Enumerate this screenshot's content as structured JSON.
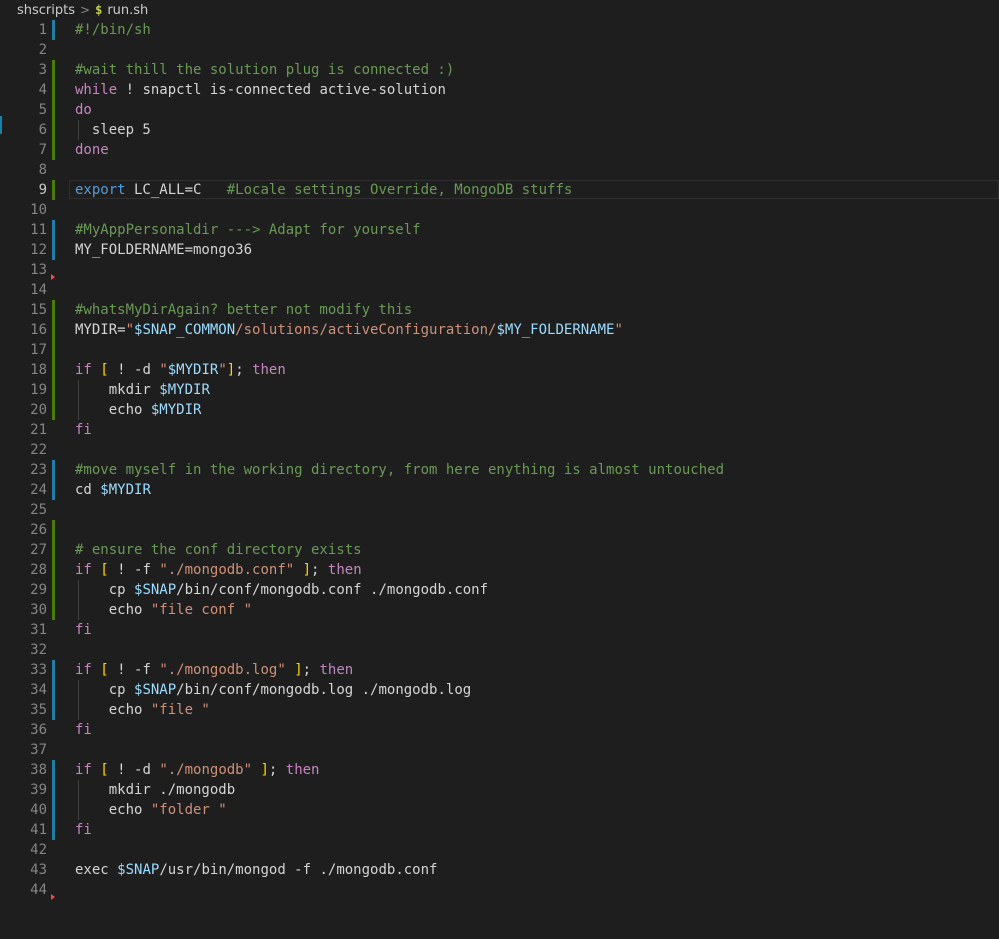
{
  "breadcrumb": {
    "folder": "shscripts",
    "separator": ">",
    "file_icon": "$",
    "file": "run.sh"
  },
  "editor": {
    "current_line": 9,
    "lines": [
      {
        "n": "1",
        "mark": "modified",
        "tokens": [
          {
            "t": "#!/bin/sh",
            "c": "comment"
          }
        ]
      },
      {
        "n": "2",
        "mark": "",
        "tokens": []
      },
      {
        "n": "3",
        "mark": "added",
        "tokens": [
          {
            "t": "#wait thill the solution plug is connected :)",
            "c": "comment"
          }
        ]
      },
      {
        "n": "4",
        "mark": "added",
        "tokens": [
          {
            "t": "while",
            "c": "kw"
          },
          {
            "t": " ! snapctl is-connected active-solution",
            "c": ""
          }
        ]
      },
      {
        "n": "5",
        "mark": "added",
        "tokens": [
          {
            "t": "do",
            "c": "kw"
          }
        ]
      },
      {
        "n": "6",
        "mark": "added",
        "guide": [
          78
        ],
        "tokens": [
          {
            "t": "  sleep 5",
            "c": ""
          }
        ]
      },
      {
        "n": "7",
        "mark": "added",
        "tokens": [
          {
            "t": "done",
            "c": "kw"
          }
        ]
      },
      {
        "n": "8",
        "mark": "",
        "tokens": []
      },
      {
        "n": "9",
        "mark": "added",
        "tokens": [
          {
            "t": "export",
            "c": "blue"
          },
          {
            "t": " LC_ALL=C   ",
            "c": ""
          },
          {
            "t": "#Locale settings Override, MongoDB stuffs",
            "c": "comment"
          }
        ]
      },
      {
        "n": "10",
        "mark": "",
        "tokens": []
      },
      {
        "n": "11",
        "mark": "modified",
        "tokens": [
          {
            "t": "#MyAppPersonaldir ---> Adapt for yourself",
            "c": "comment"
          }
        ]
      },
      {
        "n": "12",
        "mark": "modified",
        "tokens": [
          {
            "t": "MY_FOLDERNAME=mongo36",
            "c": ""
          }
        ]
      },
      {
        "n": "13",
        "mark": "deleted",
        "tokens": []
      },
      {
        "n": "14",
        "mark": "",
        "tokens": []
      },
      {
        "n": "15",
        "mark": "added",
        "tokens": [
          {
            "t": "#whatsMyDirAgain? better not modify this",
            "c": "comment"
          }
        ]
      },
      {
        "n": "16",
        "mark": "added",
        "tokens": [
          {
            "t": "MYDIR=",
            "c": ""
          },
          {
            "t": "\"",
            "c": "str"
          },
          {
            "t": "$SNAP_COMMON",
            "c": "var"
          },
          {
            "t": "/solutions/activeConfiguration/",
            "c": "str"
          },
          {
            "t": "$MY_FOLDERNAME",
            "c": "var"
          },
          {
            "t": "\"",
            "c": "str"
          }
        ]
      },
      {
        "n": "17",
        "mark": "added",
        "tokens": []
      },
      {
        "n": "18",
        "mark": "added",
        "tokens": [
          {
            "t": "if",
            "c": "kw"
          },
          {
            "t": " ",
            "c": ""
          },
          {
            "t": "[",
            "c": "gold"
          },
          {
            "t": " ! -d ",
            "c": ""
          },
          {
            "t": "\"",
            "c": "str"
          },
          {
            "t": "$MYDIR",
            "c": "var"
          },
          {
            "t": "\"",
            "c": "str"
          },
          {
            "t": "]",
            "c": "gold"
          },
          {
            "t": "; ",
            "c": ""
          },
          {
            "t": "then",
            "c": "kw"
          }
        ]
      },
      {
        "n": "19",
        "mark": "added",
        "guide": [
          78
        ],
        "tokens": [
          {
            "t": "    mkdir ",
            "c": ""
          },
          {
            "t": "$MYDIR",
            "c": "var"
          }
        ]
      },
      {
        "n": "20",
        "mark": "added",
        "guide": [
          78
        ],
        "tokens": [
          {
            "t": "    echo ",
            "c": ""
          },
          {
            "t": "$MYDIR",
            "c": "var"
          }
        ]
      },
      {
        "n": "21",
        "mark": "",
        "tokens": [
          {
            "t": "fi",
            "c": "kw"
          }
        ]
      },
      {
        "n": "22",
        "mark": "",
        "tokens": []
      },
      {
        "n": "23",
        "mark": "modified",
        "tokens": [
          {
            "t": "#move myself in the working directory, from here enything is almost untouched",
            "c": "comment"
          }
        ]
      },
      {
        "n": "24",
        "mark": "modified",
        "tokens": [
          {
            "t": "cd ",
            "c": ""
          },
          {
            "t": "$MYDIR",
            "c": "var"
          }
        ]
      },
      {
        "n": "25",
        "mark": "",
        "tokens": []
      },
      {
        "n": "26",
        "mark": "added",
        "tokens": []
      },
      {
        "n": "27",
        "mark": "added",
        "tokens": [
          {
            "t": "# ensure the conf directory exists",
            "c": "comment"
          }
        ]
      },
      {
        "n": "28",
        "mark": "added",
        "tokens": [
          {
            "t": "if",
            "c": "kw"
          },
          {
            "t": " ",
            "c": ""
          },
          {
            "t": "[",
            "c": "gold"
          },
          {
            "t": " ! -f ",
            "c": ""
          },
          {
            "t": "\"./mongodb.conf\"",
            "c": "str"
          },
          {
            "t": " ",
            "c": ""
          },
          {
            "t": "]",
            "c": "gold"
          },
          {
            "t": "; ",
            "c": ""
          },
          {
            "t": "then",
            "c": "kw"
          }
        ]
      },
      {
        "n": "29",
        "mark": "added",
        "guide": [
          78
        ],
        "tokens": [
          {
            "t": "    cp ",
            "c": ""
          },
          {
            "t": "$SNAP",
            "c": "var"
          },
          {
            "t": "/bin/conf/mongodb.conf ./mongodb.conf",
            "c": ""
          }
        ]
      },
      {
        "n": "30",
        "mark": "added",
        "guide": [
          78
        ],
        "tokens": [
          {
            "t": "    echo ",
            "c": ""
          },
          {
            "t": "\"file conf \"",
            "c": "str"
          }
        ]
      },
      {
        "n": "31",
        "mark": "",
        "tokens": [
          {
            "t": "fi",
            "c": "kw"
          }
        ]
      },
      {
        "n": "32",
        "mark": "",
        "tokens": []
      },
      {
        "n": "33",
        "mark": "modified",
        "tokens": [
          {
            "t": "if",
            "c": "kw"
          },
          {
            "t": " ",
            "c": ""
          },
          {
            "t": "[",
            "c": "gold"
          },
          {
            "t": " ! -f ",
            "c": ""
          },
          {
            "t": "\"./mongodb.log\"",
            "c": "str"
          },
          {
            "t": " ",
            "c": ""
          },
          {
            "t": "]",
            "c": "gold"
          },
          {
            "t": "; ",
            "c": ""
          },
          {
            "t": "then",
            "c": "kw"
          }
        ]
      },
      {
        "n": "34",
        "mark": "modified",
        "guide": [
          78
        ],
        "tokens": [
          {
            "t": "    cp ",
            "c": ""
          },
          {
            "t": "$SNAP",
            "c": "var"
          },
          {
            "t": "/bin/conf/mongodb.log ./mongodb.log",
            "c": ""
          }
        ]
      },
      {
        "n": "35",
        "mark": "modified",
        "guide": [
          78
        ],
        "tokens": [
          {
            "t": "    echo ",
            "c": ""
          },
          {
            "t": "\"file \"",
            "c": "str"
          }
        ]
      },
      {
        "n": "36",
        "mark": "",
        "tokens": [
          {
            "t": "fi",
            "c": "kw"
          }
        ]
      },
      {
        "n": "37",
        "mark": "",
        "tokens": []
      },
      {
        "n": "38",
        "mark": "modified",
        "tokens": [
          {
            "t": "if",
            "c": "kw"
          },
          {
            "t": " ",
            "c": ""
          },
          {
            "t": "[",
            "c": "gold"
          },
          {
            "t": " ! -d ",
            "c": ""
          },
          {
            "t": "\"./mongodb\"",
            "c": "str"
          },
          {
            "t": " ",
            "c": ""
          },
          {
            "t": "]",
            "c": "gold"
          },
          {
            "t": "; ",
            "c": ""
          },
          {
            "t": "then",
            "c": "kw"
          }
        ]
      },
      {
        "n": "39",
        "mark": "modified",
        "guide": [
          78
        ],
        "tokens": [
          {
            "t": "    mkdir ./mongodb",
            "c": ""
          }
        ]
      },
      {
        "n": "40",
        "mark": "modified",
        "guide": [
          78
        ],
        "tokens": [
          {
            "t": "    echo ",
            "c": ""
          },
          {
            "t": "\"folder \"",
            "c": "str"
          }
        ]
      },
      {
        "n": "41",
        "mark": "modified",
        "tokens": [
          {
            "t": "fi",
            "c": "kw"
          }
        ]
      },
      {
        "n": "42",
        "mark": "",
        "tokens": []
      },
      {
        "n": "43",
        "mark": "",
        "tokens": [
          {
            "t": "exec ",
            "c": ""
          },
          {
            "t": "$SNAP",
            "c": "var"
          },
          {
            "t": "/usr/bin/mongod -f ./mongodb.conf",
            "c": ""
          }
        ]
      },
      {
        "n": "44",
        "mark": "deleted",
        "tokens": []
      }
    ]
  }
}
